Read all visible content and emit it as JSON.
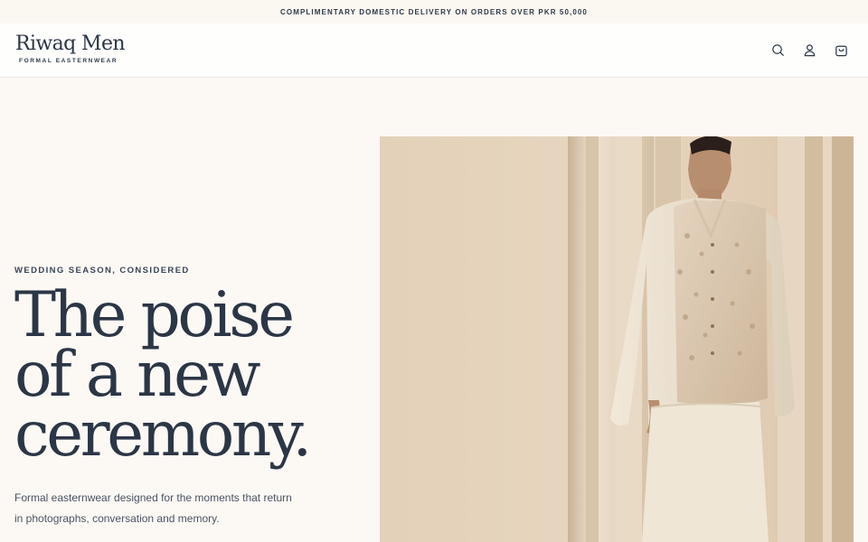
{
  "announcement": "COMPLIMENTARY DOMESTIC DELIVERY ON ORDERS OVER PKR 50,000",
  "brand": {
    "name": "Riwaq Men",
    "tagline": "FORMAL EASTERNWEAR"
  },
  "header": {
    "icons": [
      "search-icon",
      "account-icon",
      "bag-icon"
    ]
  },
  "hero": {
    "eyebrow": "WEDDING SEASON, CONSIDERED",
    "headline": [
      "The poise",
      "of a new",
      "ceremony."
    ],
    "lede_lines": [
      "Formal easternwear designed for the moments that return",
      "in photographs, conversation and memory."
    ]
  },
  "colors": {
    "background": "#fcf9f5",
    "ink": "#2b3646",
    "header_bg": "#fefefd"
  }
}
